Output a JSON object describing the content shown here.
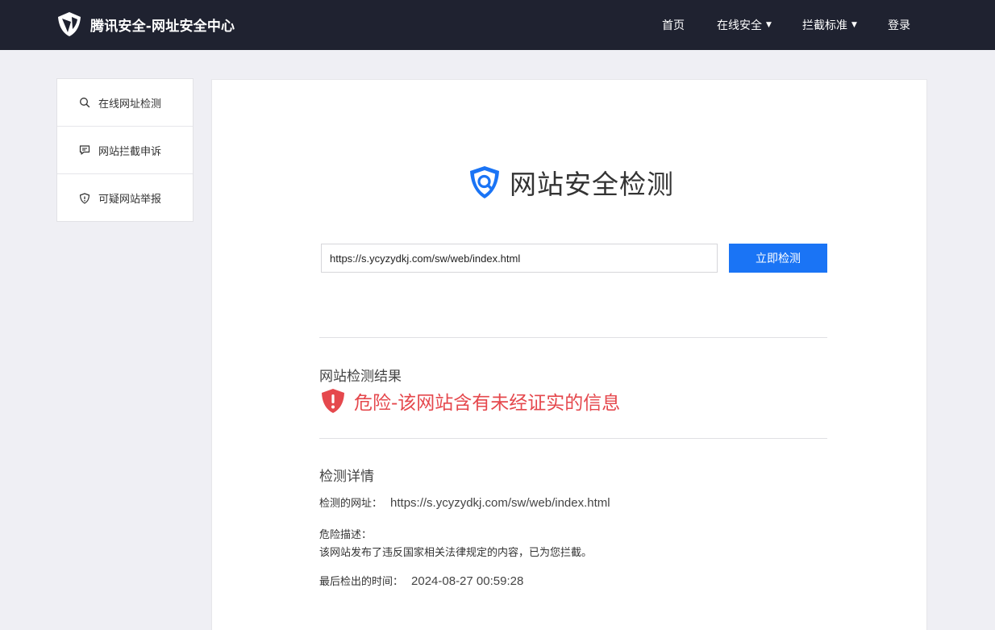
{
  "header": {
    "brand": "腾讯安全-网址安全中心",
    "nav": [
      {
        "label": "首页",
        "dropdown": false
      },
      {
        "label": "在线安全",
        "dropdown": true
      },
      {
        "label": "拦截标准",
        "dropdown": true
      },
      {
        "label": "登录",
        "dropdown": false
      }
    ]
  },
  "sidebar": {
    "items": [
      {
        "label": "在线网址检测",
        "icon": "search-icon"
      },
      {
        "label": "网站拦截申诉",
        "icon": "chat-icon"
      },
      {
        "label": "可疑网站举报",
        "icon": "shield-alert-icon"
      }
    ]
  },
  "main": {
    "title": "网站安全检测",
    "search": {
      "value": "https://s.ycyzydkj.com/sw/web/index.html",
      "button": "立即检测"
    },
    "result": {
      "heading": "网站检测结果",
      "status": "危险-该网站含有未经证实的信息",
      "status_color": "#e5484d"
    },
    "details": {
      "heading": "检测详情",
      "url_label": "检测的网址：",
      "url_value": "https://s.ycyzydkj.com/sw/web/index.html",
      "desc_label": "危险描述：",
      "desc_text": "该网站发布了违反国家相关法律规定的内容，已为您拦截。",
      "time_label": "最后检出的时间：",
      "time_value": "2024-08-27 00:59:28"
    }
  },
  "colors": {
    "header_bg": "#1f2230",
    "accent": "#1a74f5",
    "danger": "#e5484d"
  }
}
